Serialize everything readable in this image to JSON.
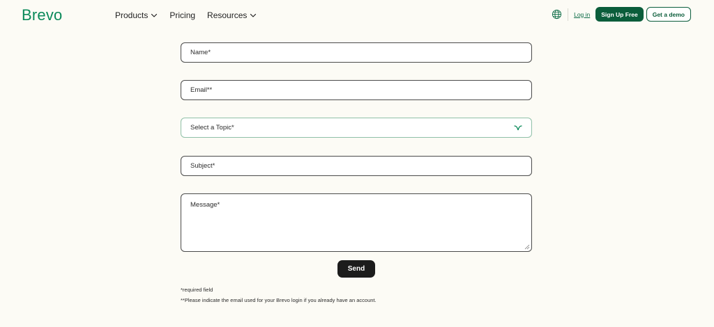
{
  "header": {
    "logo": "Brevo",
    "nav": [
      {
        "label": "Products",
        "has_dropdown": true
      },
      {
        "label": "Pricing",
        "has_dropdown": false
      },
      {
        "label": "Resources",
        "has_dropdown": true
      }
    ],
    "login_label": "Log in",
    "signup_label": "Sign Up Free",
    "demo_label": "Get a demo"
  },
  "form": {
    "name_placeholder": "Name*",
    "email_placeholder": "Email**",
    "topic_placeholder": "Select a Topic*",
    "subject_placeholder": "Subject*",
    "message_placeholder": "Message*",
    "send_label": "Send"
  },
  "notes": {
    "required": "*required field",
    "email_hint": "**Please indicate the email used for your Brevo login if you already have an account."
  },
  "colors": {
    "background": "#fcfbf5",
    "brand_green": "#0b8a5a",
    "dark_green": "#0b5d3b",
    "send_button": "#1c1c1c"
  },
  "icons": {
    "globe": "globe-icon",
    "chevron": "chevron-down-icon",
    "select_arrow": "select-arrow-icon"
  }
}
